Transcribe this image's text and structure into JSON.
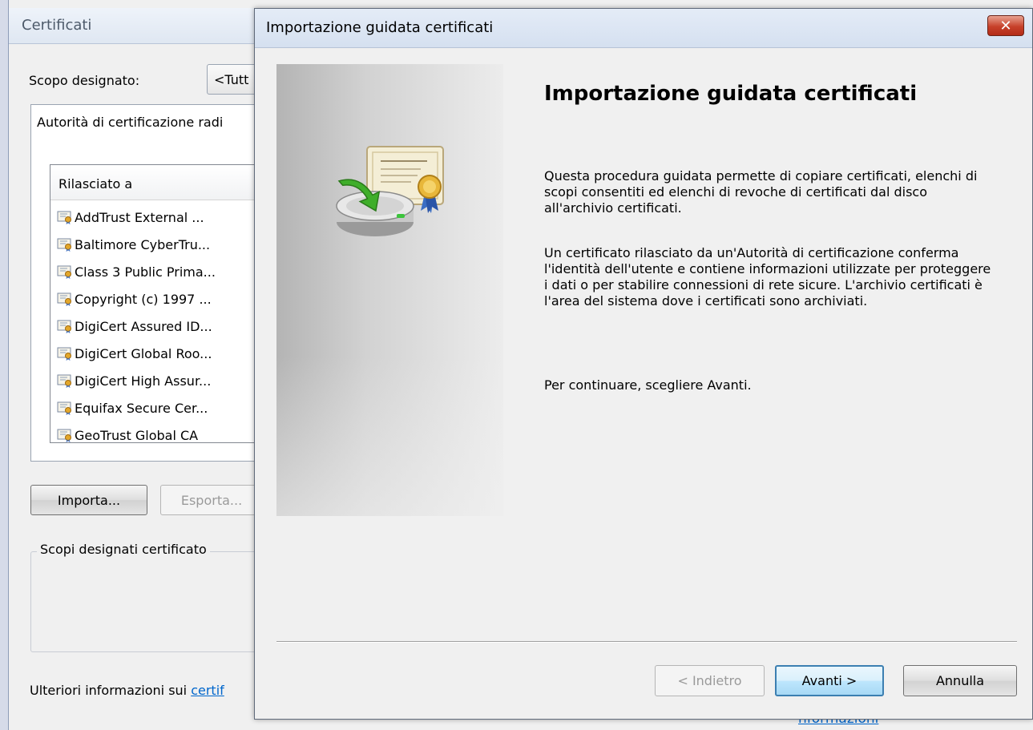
{
  "background_window": {
    "title": "Certificati",
    "scope_label": "Scopo designato:",
    "scope_value": "<Tutt",
    "tab_label": "Autorità di certificazione radi",
    "list": {
      "column_header": "Rilasciato a",
      "rows": [
        {
          "name": "AddTrust External ..."
        },
        {
          "name": "Baltimore CyberTru..."
        },
        {
          "name": "Class 3 Public Prima..."
        },
        {
          "name": "Copyright (c) 1997 ..."
        },
        {
          "name": "DigiCert Assured ID..."
        },
        {
          "name": "DigiCert Global Roo..."
        },
        {
          "name": "DigiCert High Assur..."
        },
        {
          "name": "Equifax Secure Cer..."
        },
        {
          "name": "GeoTrust Global CA"
        }
      ]
    },
    "import_button": "Importa...",
    "export_button": "Esporta...",
    "purposes_group_label": "Scopi designati certificato",
    "more_info_text": "Ulteriori informazioni sui ",
    "more_info_link": "certif",
    "bottom_link": "nformazioni"
  },
  "wizard": {
    "title": "Importazione guidata certificati",
    "close_label": "✕",
    "heading": "Importazione guidata certificati",
    "paragraph1": "Questa procedura guidata permette di copiare certificati, elenchi di scopi consentiti ed elenchi di revoche di certificati dal disco all'archivio certificati.",
    "paragraph2": "Un certificato rilasciato da un'Autorità di certificazione conferma l'identità dell'utente e contiene informazioni utilizzate per proteggere i dati o per stabilire connessioni di rete sicure. L'archivio certificati è l'area del sistema dove i certificati sono archiviati.",
    "paragraph3": "Per continuare, scegliere Avanti.",
    "back_button": "< Indietro",
    "next_button": "Avanti >",
    "cancel_button": "Annulla",
    "icon": "certificate-import-icon"
  }
}
